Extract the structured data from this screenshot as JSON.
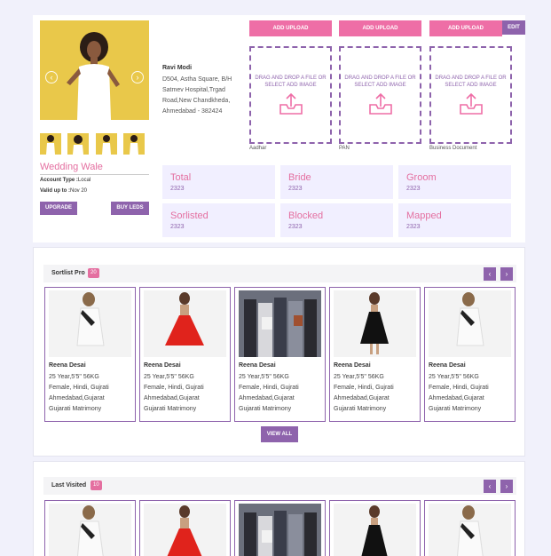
{
  "profile": {
    "name": "Ravi Modi",
    "address_lines": [
      "D504, Astha Square, B/H",
      "Satmev Hospital,Trgad",
      "Road,New Chandkheda,",
      "Ahmedabad - 382424"
    ],
    "brand": "Wedding Wale",
    "account_type_label": "Account Type :",
    "account_type_value": "Local",
    "valid_up_to_label": "Valid up to :",
    "valid_up_to_value": "Nov 20",
    "upgrade_label": "UPGRADE",
    "buy_leads_label": "BUY LEDS",
    "prev_arrow": "‹",
    "next_arrow": "›"
  },
  "uploads": [
    {
      "button": "ADD UPLOAD",
      "drop_text": "DRAG AND DROP A FILE OR SELECT ADD IMAGE",
      "label": "Aadhar"
    },
    {
      "button": "ADD UPLOAD",
      "drop_text": "DRAG AND DROP A FILE OR SELECT ADD IMAGE",
      "label": "PAN"
    },
    {
      "button": "ADD UPLOAD",
      "drop_text": "DRAG AND DROP A FILE OR SELECT ADD IMAGE",
      "label": "Business Document"
    }
  ],
  "edit_label": "EDIT",
  "stats": [
    {
      "label": "Total",
      "value": "2323"
    },
    {
      "label": "Bride",
      "value": "2323"
    },
    {
      "label": "Groom",
      "value": "2323"
    },
    {
      "label": "Sorlisted",
      "value": "2323"
    },
    {
      "label": "Blocked",
      "value": "2323"
    },
    {
      "label": "Mapped",
      "value": "2323"
    }
  ],
  "sortlist": {
    "title": "Sortlist Pro",
    "count": "20",
    "prev": "‹",
    "next": "›",
    "view_all": "VIEW ALL",
    "cards": [
      {
        "name": "Reena Desai",
        "line1": "25 Year,5'5\" 56KG",
        "line2": "Female, Hindi, Gujrati",
        "line3": "Ahmedabad,Gujarat",
        "line4": "Gujarati Matrimony"
      },
      {
        "name": "Reena Desai",
        "line1": "25 Year,5'5\" 56KG",
        "line2": "Female, Hindi, Gujrati",
        "line3": "Ahmedabad,Gujarat",
        "line4": "Gujarati Matrimony"
      },
      {
        "name": "Reena Desai",
        "line1": "25 Year,5'5\" 56KG",
        "line2": "Female, Hindi, Gujrati",
        "line3": "Ahmedabad,Gujarat",
        "line4": "Gujarati Matrimony"
      },
      {
        "name": "Reena Desai",
        "line1": "25 Year,5'5\" 56KG",
        "line2": "Female, Hindi, Gujrati",
        "line3": "Ahmedabad,Gujarat",
        "line4": "Gujarati Matrimony"
      },
      {
        "name": "Reena Desai",
        "line1": "25 Year,5'5\" 56KG",
        "line2": "Female, Hindi, Gujrati",
        "line3": "Ahmedabad,Gujarat",
        "line4": "Gujarati Matrimony"
      }
    ]
  },
  "last_visited": {
    "title": "Last Visited",
    "count": "10",
    "prev": "‹",
    "next": "›"
  },
  "colors": {
    "accent_pink": "#ee6ea6",
    "accent_purple": "#8e63ac",
    "photo_bg": "#e9c84a",
    "stat_bg": "#f1efff"
  }
}
